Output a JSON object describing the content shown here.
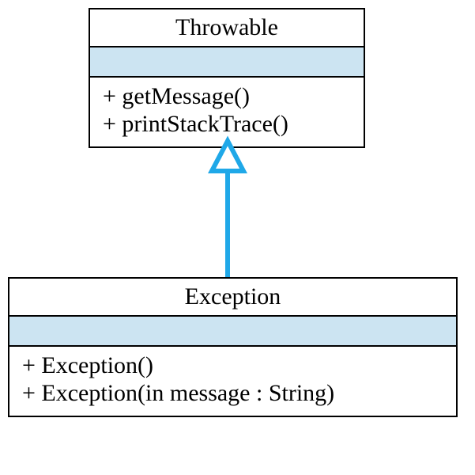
{
  "classes": {
    "throwable": {
      "name": "Throwable",
      "methods": [
        "+ getMessage()",
        "+ printStackTrace()"
      ]
    },
    "exception": {
      "name": "Exception",
      "methods": [
        "+ Exception()",
        "+ Exception(in message : String)"
      ]
    }
  },
  "relationship": {
    "type": "generalization",
    "from": "exception",
    "to": "throwable"
  }
}
